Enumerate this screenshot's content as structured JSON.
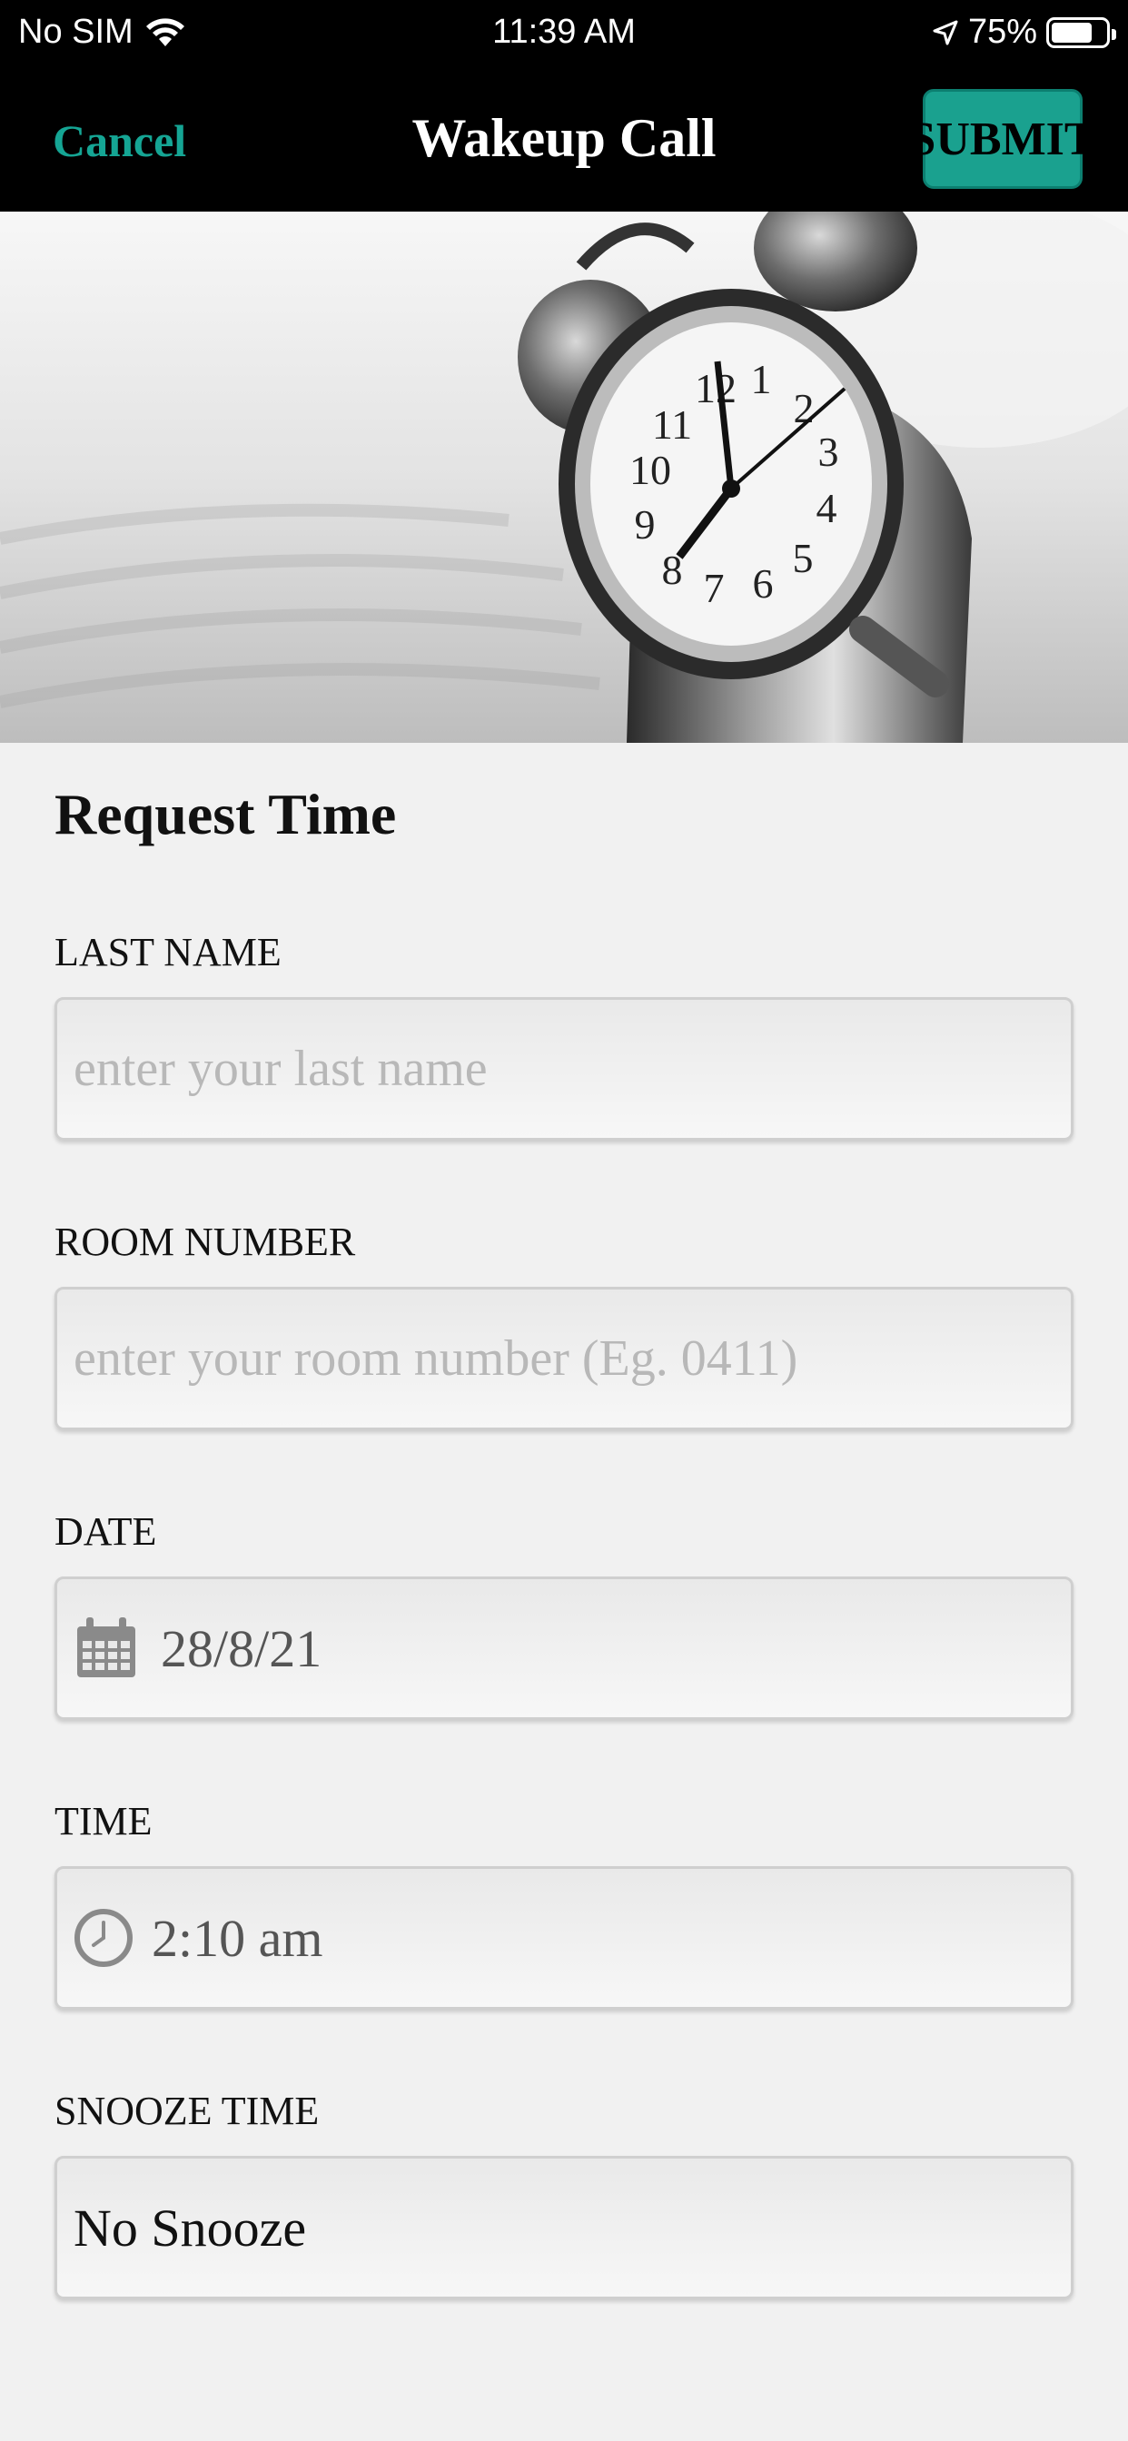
{
  "status_bar": {
    "carrier": "No SIM",
    "time": "11:39 AM",
    "battery": "75%",
    "battery_level": 0.75
  },
  "nav": {
    "cancel_label": "Cancel",
    "title": "Wakeup Call",
    "submit_label": "SUBMIT"
  },
  "form": {
    "title": "Request Time",
    "last_name": {
      "label": "LAST NAME",
      "placeholder": "enter your last name",
      "value": ""
    },
    "room_number": {
      "label": "ROOM NUMBER",
      "placeholder": "enter your room number (Eg. 0411)",
      "value": ""
    },
    "date": {
      "label": "DATE",
      "value": "28/8/21",
      "icon": "calendar-icon"
    },
    "time": {
      "label": "TIME",
      "value": "2:10 am",
      "icon": "clock-icon"
    },
    "snooze": {
      "label": "SNOOZE TIME",
      "value": "No Snooze"
    }
  },
  "hero": {
    "image": "alarm-clock-photo",
    "clock_numbers": [
      "12",
      "1",
      "2",
      "3",
      "4",
      "5",
      "6",
      "7",
      "8",
      "9",
      "10",
      "11"
    ]
  },
  "colors": {
    "accent": "#1aa18f",
    "cancel_text": "#15a594",
    "bar_bg": "#000000",
    "page_bg": "#f1f1f1"
  }
}
